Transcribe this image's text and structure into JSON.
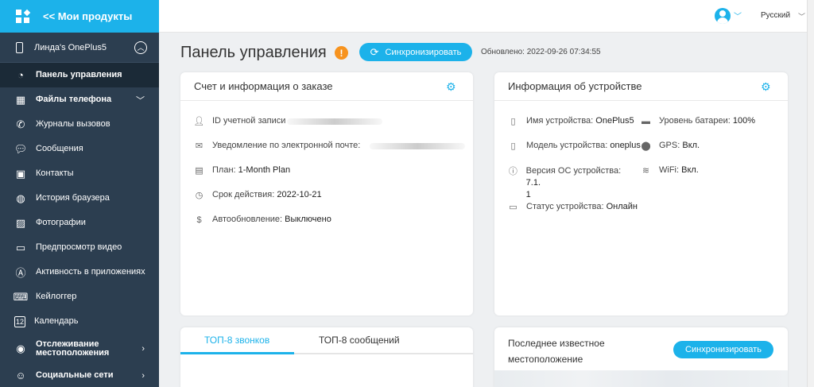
{
  "sidebar": {
    "back_label": "<< Мои продукты",
    "device_name": "Линда's OnePlus5",
    "items": [
      {
        "label": "Панель управления",
        "icon": "dashboard-icon",
        "active": true
      },
      {
        "label": "Файлы телефона",
        "icon": "calendar-file-icon",
        "chevron": true
      },
      {
        "label": "Журналы вызовов",
        "icon": "phone-icon"
      },
      {
        "label": "Сообщения",
        "icon": "chat-icon"
      },
      {
        "label": "Контакты",
        "icon": "contact-icon"
      },
      {
        "label": "История браузера",
        "icon": "globe-icon"
      },
      {
        "label": "Фотографии",
        "icon": "image-icon"
      },
      {
        "label": "Предпросмотр видео",
        "icon": "video-icon"
      },
      {
        "label": "Активность в приложениях",
        "icon": "app-icon"
      },
      {
        "label": "Кейлоггер",
        "icon": "keyboard-icon"
      },
      {
        "label": "Календарь",
        "icon": "calendar-icon"
      },
      {
        "label": "Отслеживание местоположения",
        "icon": "location-icon",
        "chevron": true
      },
      {
        "label": "Социальные сети",
        "icon": "social-icon",
        "chevron": true
      }
    ]
  },
  "header": {
    "language": "Русский"
  },
  "main": {
    "title": "Панель управления",
    "sync_label": "Синхронизировать",
    "updated": "Обновлено: 2022-09-26 07:34:55"
  },
  "account_card": {
    "title": "Счет и информация о заказе",
    "rows": [
      {
        "label": "ID учетной записи",
        "value": ""
      },
      {
        "label": "Уведомление по электронной почте:",
        "value": ""
      },
      {
        "label": "План:",
        "value": "1-Month Plan"
      },
      {
        "label": "Срок действия:",
        "value": "2022-10-21"
      },
      {
        "label": "Автообновление:",
        "value": "Выключено"
      }
    ]
  },
  "device_card": {
    "title": "Информация об устройстве",
    "device_name_label": "Имя устройства:",
    "device_name_value": "OnePlus5",
    "battery_label": "Уровень батареи:",
    "battery_value": "100%",
    "model_label": "Модель устройства:",
    "model_value": "oneplus",
    "gps_label": "GPS:",
    "gps_value": "Вкл.",
    "os_label": "Версия ОС устройства:",
    "os_value_1": "7.1.",
    "os_value_2": "1",
    "wifi_label": "WiFi:",
    "wifi_value": "Вкл.",
    "status_label": "Статус устройства:",
    "status_value": "Онлайн"
  },
  "top_card": {
    "tab_calls": "ТОП-8 звонков",
    "tab_messages": "ТОП-8 сообщений"
  },
  "location_card": {
    "title": "Последнее известное местоположение",
    "sync_label": "Синхронизировать"
  },
  "colors": {
    "accent": "#1cb2ea",
    "sidebar": "#2c3e50",
    "warning": "#f7931e"
  }
}
